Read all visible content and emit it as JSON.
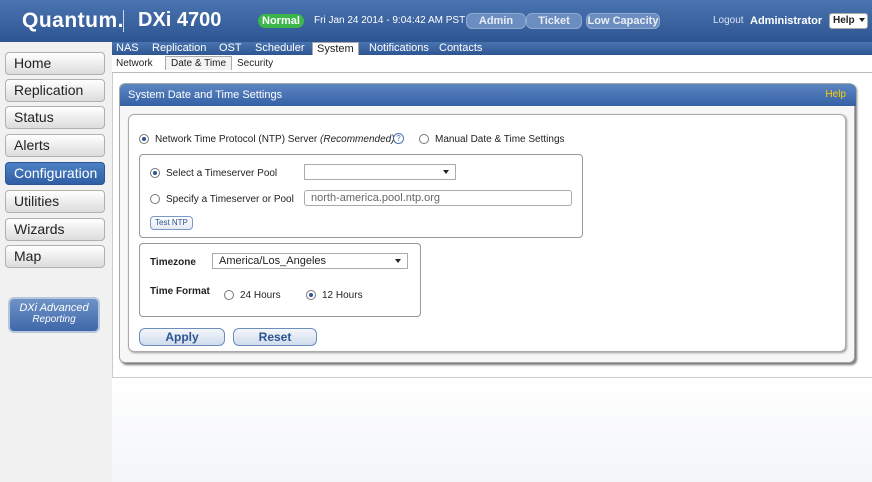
{
  "header": {
    "logo": "Quantum.",
    "product": "DXi 4700",
    "status_badge": "Normal",
    "datetime": "Fri Jan 24 2014 - 9:04:42 AM PST",
    "buttons": [
      "Admin",
      "Ticket",
      "Low Capacity"
    ],
    "logout": "Logout",
    "user": "Administrator",
    "help": "Help"
  },
  "leftnav": {
    "items": [
      {
        "label": "Home"
      },
      {
        "label": "Replication"
      },
      {
        "label": "Status"
      },
      {
        "label": "Alerts"
      },
      {
        "label": "Configuration"
      },
      {
        "label": "Utilities"
      },
      {
        "label": "Wizards"
      },
      {
        "label": "Map"
      }
    ],
    "dxi_advanced": {
      "line1": "DXi Advanced",
      "line2": "Reporting"
    }
  },
  "tabs": [
    "NAS",
    "Replication",
    "OST",
    "Scheduler",
    "System",
    "Notifications",
    "Contacts"
  ],
  "active_tab": "System",
  "subtabs": [
    "Network",
    "Date & Time",
    "Security"
  ],
  "active_subtab": "Date & Time",
  "panel": {
    "title": "System Date and Time Settings",
    "help": "Help",
    "ntp_option": "Network Time Protocol (NTP) Server",
    "ntp_recommended": "(Recommended)",
    "help_mark": "?",
    "manual_option": "Manual Date & Time Settings",
    "select_pool_label": "Select a Timeserver Pool",
    "select_pool_value": "",
    "specify_server_label": "Specify a Timeserver or Pool",
    "specify_server_placeholder": "north-america.pool.ntp.org",
    "test_ntp": "Test NTP",
    "timezone_label": "Timezone",
    "timezone_value": "America/Los_Angeles",
    "time_format_label": "Time Format",
    "format_24": "24 Hours",
    "format_12": "12 Hours",
    "apply": "Apply",
    "reset": "Reset"
  }
}
